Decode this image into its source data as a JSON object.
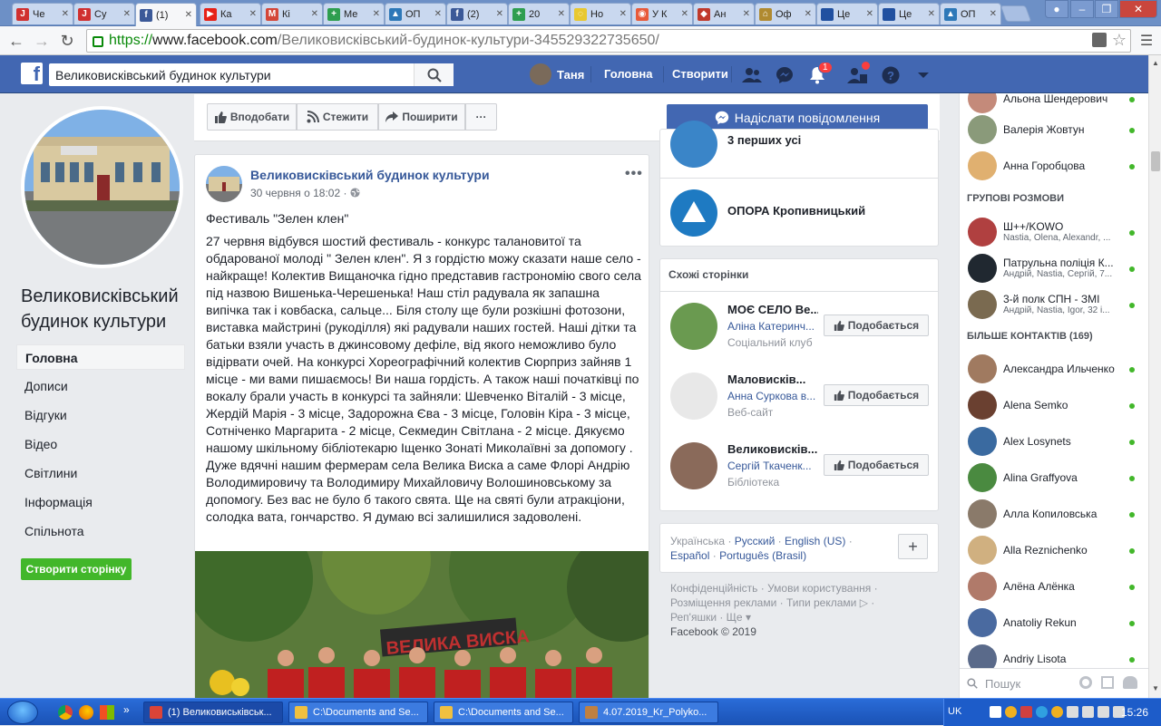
{
  "browser": {
    "tabs": [
      {
        "title": "Че",
        "fav": "J",
        "color": "#d03030"
      },
      {
        "title": "Су",
        "fav": "J",
        "color": "#d03030"
      },
      {
        "title": "(1)",
        "fav": "f",
        "color": "#3b5998",
        "active": true
      },
      {
        "title": "Ка",
        "fav": "▶",
        "color": "#e62117"
      },
      {
        "title": "Кі",
        "fav": "M",
        "color": "#d44638"
      },
      {
        "title": "Ме",
        "fav": "+",
        "color": "#2e9e4f"
      },
      {
        "title": "ОП",
        "fav": "▲",
        "color": "#2d78b8"
      },
      {
        "title": "(2)",
        "fav": "f",
        "color": "#3b5998"
      },
      {
        "title": "20",
        "fav": "+",
        "color": "#2e9e4f"
      },
      {
        "title": "Но",
        "fav": "◌",
        "color": "#e8c830"
      },
      {
        "title": "У К",
        "fav": "◉",
        "color": "#e85a3a"
      },
      {
        "title": "Ан",
        "fav": "◆",
        "color": "#c0392b"
      },
      {
        "title": "Оф",
        "fav": "⌂",
        "color": "#b08a30"
      },
      {
        "title": "Це",
        "fav": "ЦВК",
        "color": "#2050a0"
      },
      {
        "title": "Це",
        "fav": "ЦВК",
        "color": "#2050a0"
      },
      {
        "title": "ОП",
        "fav": "▲",
        "color": "#2d78b8"
      }
    ],
    "url_scheme": "https://",
    "url_domain": "www.facebook.com",
    "url_path": "/Великовисківський-будинок-культури-345529322735650/"
  },
  "fb": {
    "search_value": "Великовисківський будинок культури",
    "user_name": "Таня",
    "nav_home": "Головна",
    "nav_create": "Створити",
    "notif_count": "1"
  },
  "left": {
    "page_name": "Великовисківський будинок культури",
    "nav": [
      "Головна",
      "Дописи",
      "Відгуки",
      "Відео",
      "Світлини",
      "Інформація",
      "Спільнота"
    ],
    "create_page": "Створити сторінку"
  },
  "actions": {
    "like": "Вподобати",
    "follow": "Стежити",
    "share": "Поширити",
    "more": "···",
    "message": "Надіслати повідомлення"
  },
  "post": {
    "author": "Великовисківський будинок культури",
    "date": "30 червня о 18:02 ·",
    "title": "Фестиваль \"Зелен клен\"",
    "body": "27 червня відбувся шостий фестиваль - конкурс талановитої та обдарованої молоді \" Зелен клен\". Я з гордістю можу сказати наше село - найкраще! Колектив Вищаночка гідно представив гастрономію свого села під назвою Вишенька-Черешенька! Наш стіл радувала як запашна випічка так і ковбаска, сальце... Біля столу ще були розкішні фотозони, виставка майстрині (рукоділля) які радували наших гостей. Наші дітки та батьки взяли участь в джинсовому дефіле, від якого неможливо було відірвати очей. На конкурсі Хореографічний колектив Сюрприз зайняв 1 місце - ми вами пишаємось! Ви наша гордість. А також наші початківці по вокалу брали участь в конкурсі та зайняли: Шевченко Віталій - 3 місце, Жердій Марія - 3 місце, Задорожна Єва - 3 місце, Головін Кіра - 3 місце, Сотніченко Маргарита - 2 місце, Секмедин Світлана - 2 місце. Дякуємо нашому шкільному бібліотекарю Іщенко Зонаті Миколаївні за допомогу . Дуже вдячні нашим фермерам села Велика Виска а саме Флорі Андрію Володимировичу та Володимиру Михайловичу Волошиновському за допомогу. Без вас не було б такого свята. Ще на святі були атракціони, солодка вата, гончарство. Я думаю всі залишилися задоволені.",
    "photo_banner": "ВЕЛИКА ВИСКА"
  },
  "right": {
    "partial_item": "3 перших усі",
    "opora": "ОПОРА Кропивницький",
    "similar_title": "Схожі сторінки",
    "similar": [
      {
        "name": "МОЄ СЕЛО Ве...",
        "sub": "Аліна Катеринч...",
        "cat": "Соціальний клуб",
        "btn": "Подобається"
      },
      {
        "name": "Маловисків...",
        "sub": "Анна Суркова в...",
        "cat": "Веб-сайт",
        "btn": "Подобається"
      },
      {
        "name": "Великовисків...",
        "sub": "Сергій Ткаченк...",
        "cat": "Бібліотека",
        "btn": "Подобається"
      }
    ],
    "languages": [
      "Українська",
      "Русский",
      "English (US)",
      "Español",
      "Português (Brasil)"
    ],
    "lang_sep": "·",
    "plus": "+",
    "footer1": "Конфіденційність · Умови користування ·",
    "footer2": "Розміщення реклами · Типи реклами ▷ ·",
    "footer3": "Реп'яшки · Ще ▾",
    "copyright": "Facebook © 2019"
  },
  "chat": {
    "top_contacts": [
      {
        "name": "Альона Шендерович"
      },
      {
        "name": "Валерія Жовтун"
      },
      {
        "name": "Анна Горобцова"
      }
    ],
    "group_title": "ГРУПОВІ РОЗМОВИ",
    "groups": [
      {
        "name": "Ш++/KOWO",
        "sub": "Nastia, Olena, Alexandr, ..."
      },
      {
        "name": "Патрульна поліція К...",
        "sub": "Андрій, Nastia, Сергій, 7..."
      },
      {
        "name": "3-й полк СПН - ЗМІ",
        "sub": "Андрій, Nastia, Igor, 32 і..."
      }
    ],
    "more_title": "БІЛЬШЕ КОНТАКТІВ (169)",
    "contacts": [
      {
        "name": "Александра Ильченко"
      },
      {
        "name": "Alena Semko"
      },
      {
        "name": "Alex Losynets"
      },
      {
        "name": "Alina Graffyova"
      },
      {
        "name": "Алла Копиловська"
      },
      {
        "name": "Alla Reznichenko"
      },
      {
        "name": "Алёна Алёнка"
      },
      {
        "name": "Anatoliy Rekun"
      },
      {
        "name": "Andriy Lisota"
      }
    ],
    "search_placeholder": "Пошук"
  },
  "taskbar": {
    "tasks": [
      "(1) Великовиськівськ...",
      "C:\\Documents and Se...",
      "C:\\Documents and Se...",
      "4.07.2019_Kr_Polyko..."
    ],
    "lang": "UK",
    "time": "15:26"
  }
}
